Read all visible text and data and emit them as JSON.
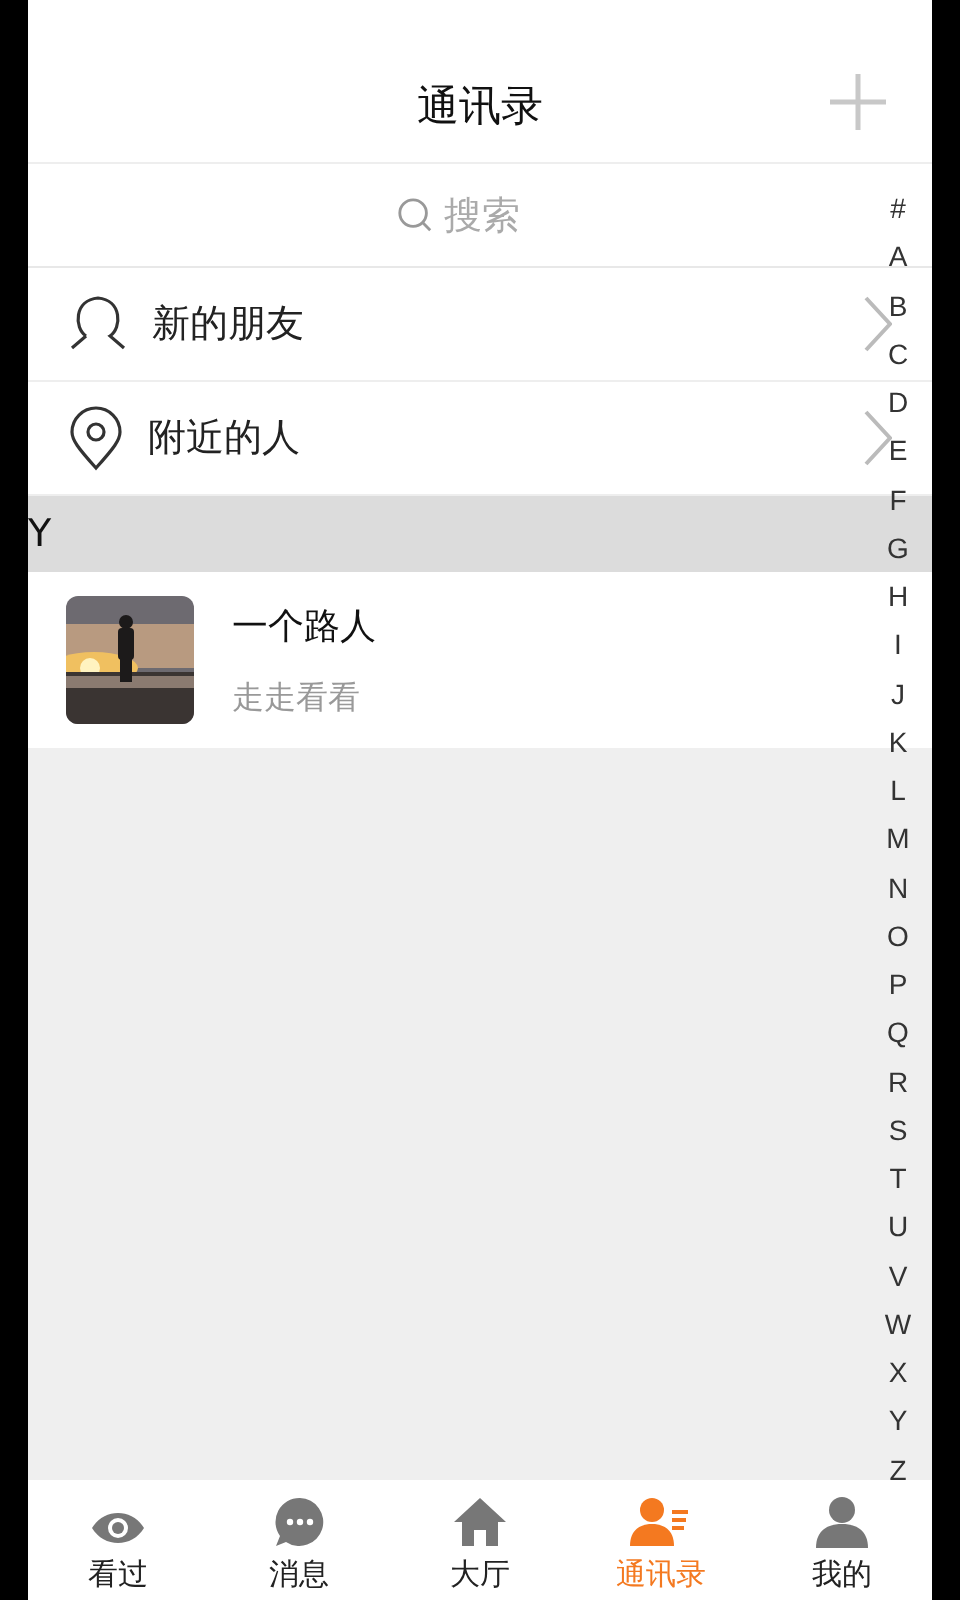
{
  "header": {
    "title": "通讯录"
  },
  "search": {
    "placeholder": "搜索"
  },
  "entries": [
    {
      "label": "新的朋友",
      "kind": "friends"
    },
    {
      "label": "附近的人",
      "kind": "nearby"
    }
  ],
  "sections": [
    {
      "letter": "Y",
      "contacts": [
        {
          "name": "一个路人",
          "status": "走走看看"
        }
      ]
    }
  ],
  "index": [
    "#",
    "A",
    "B",
    "C",
    "D",
    "E",
    "F",
    "G",
    "H",
    "I",
    "J",
    "K",
    "L",
    "M",
    "N",
    "O",
    "P",
    "Q",
    "R",
    "S",
    "T",
    "U",
    "V",
    "W",
    "X",
    "Y",
    "Z"
  ],
  "tabs": [
    {
      "label": "看过",
      "kind": "eye",
      "selected": false
    },
    {
      "label": "消息",
      "kind": "chat",
      "selected": false
    },
    {
      "label": "大厅",
      "kind": "home",
      "selected": false
    },
    {
      "label": "通讯录",
      "kind": "contacts",
      "selected": true
    },
    {
      "label": "我的",
      "kind": "person",
      "selected": false
    }
  ]
}
